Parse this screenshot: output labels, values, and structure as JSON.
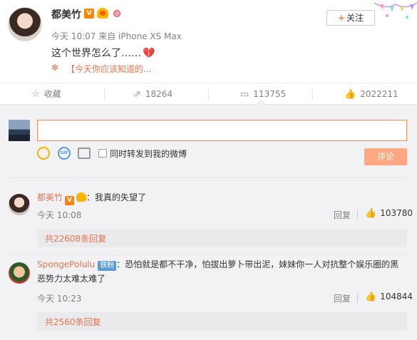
{
  "post": {
    "username": "都美竹",
    "verified_badge": "V",
    "time": "今天 10:07",
    "source": "来自 iPhone XS Max",
    "text": "这个世界怎么了……",
    "text_emoji": "broken-heart-icon",
    "topic_link": "【今天你应该知道的...",
    "follow_label": "关注",
    "follow_icon": "plus-icon"
  },
  "actions": {
    "favorite_label": "收藏",
    "repost_count": "18264",
    "comment_count": "113755",
    "like_count": "2022211"
  },
  "composer": {
    "placeholder": "",
    "repost_checkbox_label": "同时转发到我的微博",
    "submit_label": "评论"
  },
  "comments": [
    {
      "username": "都美竹",
      "badge": "V",
      "separator": "：",
      "text": "我真的失望了",
      "time": "今天 10:08",
      "reply_label": "回复",
      "likes": "103780",
      "more_replies": "共22608条回复"
    },
    {
      "username": "SpongePolulu",
      "fan_badge": "铁粉",
      "separator": "：",
      "text": "恐怕就是都不干净，怕拔出萝卜带出泥，妹妹你一人对抗整个娱乐圈的黑恶势力太难太难了",
      "time": "今天 10:23",
      "reply_label": "回复",
      "likes": "104844",
      "more_replies": "共2560条回复"
    }
  ],
  "colors": {
    "accent_orange": "#eb7350",
    "input_border": "#f28c5d",
    "submit_disabled": "#ffa782",
    "panel_bg": "#f2f2f5"
  }
}
